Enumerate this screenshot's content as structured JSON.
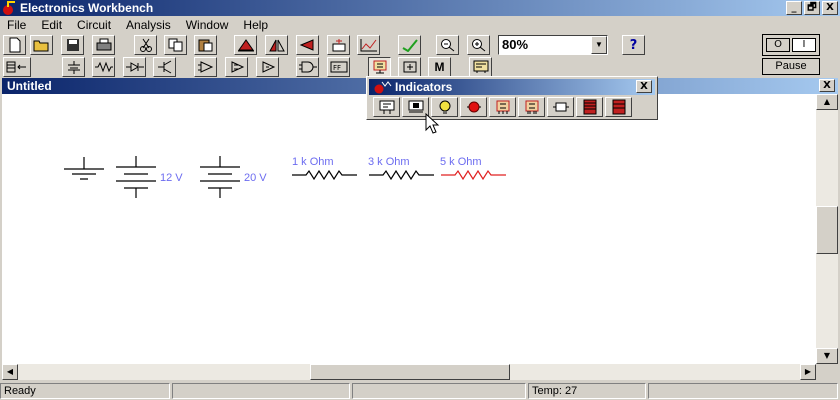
{
  "app": {
    "title": "Electronics Workbench"
  },
  "window_buttons": {
    "minimize": "_",
    "restore": "🗗",
    "close": "X"
  },
  "menu": [
    "File",
    "Edit",
    "Circuit",
    "Analysis",
    "Window",
    "Help"
  ],
  "zoom": {
    "value": "80%"
  },
  "power_switch": {
    "off_label": "O",
    "on_label": "I"
  },
  "pause": {
    "label": "Pause"
  },
  "document": {
    "title": "Untitled"
  },
  "indicators_panel": {
    "title": "Indicators"
  },
  "circuit": {
    "battery_1_label": "12 V",
    "battery_2_label": "20 V",
    "resistor_1_label": "1 k Ohm",
    "resistor_2_label": "3 k Ohm",
    "resistor_3_label": "5 k Ohm"
  },
  "status": {
    "ready": "Ready",
    "temp": "Temp:  27"
  },
  "colors": {
    "title_bar": "#0a246a",
    "label": "#6c6cf0",
    "selected_resistor": "#e02020"
  },
  "icons": {
    "toolbar_1": [
      "new-icon",
      "open-icon",
      "save-icon",
      "print-icon",
      "cut-icon",
      "copy-icon",
      "paste-icon",
      "rotate-icon",
      "flip-horizontal-icon",
      "flip-vertical-icon",
      "subcircuit-icon",
      "graph-icon",
      "component-properties-icon",
      "zoom-out-icon",
      "zoom-in-icon",
      "help-icon"
    ],
    "toolbar_2": [
      "parts-bin-icon",
      "sources-icon",
      "basic-icon",
      "diodes-icon",
      "transistors-icon",
      "analog-ics-icon",
      "mixed-ics-icon",
      "digital-ics-icon",
      "logic-gates-icon",
      "digital-icon",
      "indicators-icon",
      "controls-icon",
      "miscellaneous-icon",
      "instruments-icon"
    ],
    "indicators": [
      "voltmeter-icon",
      "ammeter-icon",
      "bulb-icon",
      "red-probe-icon",
      "seven-segment-display-icon",
      "decoded-display-icon",
      "buzzer-icon",
      "bargraph-icon",
      "bargraph-display-icon"
    ]
  }
}
